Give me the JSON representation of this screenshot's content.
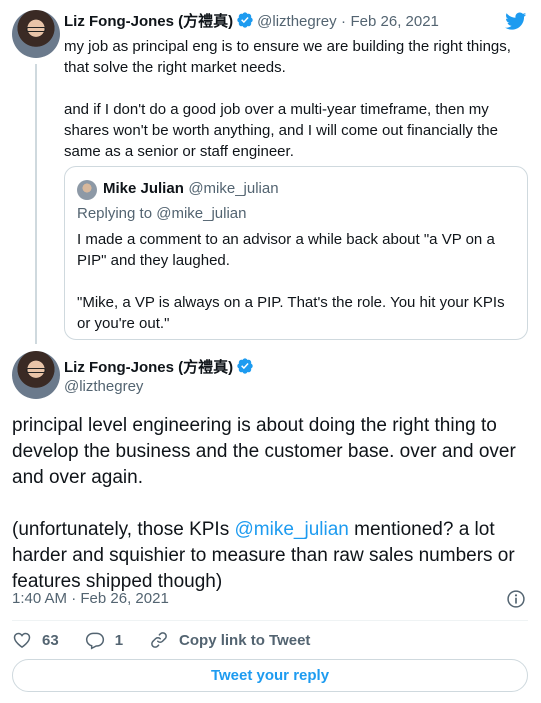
{
  "colors": {
    "accent": "#1d9bf0",
    "secondary_text": "#536471",
    "border": "#cfd9de",
    "text": "#0f1419"
  },
  "tweet1": {
    "name": "Liz Fong-Jones (方禮真)",
    "handle": "@lizthegrey",
    "separator": "·",
    "date": "Feb 26, 2021",
    "text": "my job as principal eng is to ensure we are building the right things, that solve the right market needs.\n\nand if I don't do a good job over a multi-year timeframe, then my shares won't be worth anything, and I will come out financially the same as a senior or staff engineer."
  },
  "quote": {
    "name": "Mike Julian",
    "handle": "@mike_julian",
    "replying_prefix": "Replying to",
    "replying_to": "@mike_julian",
    "text": "I made a comment to an advisor a while back about \"a VP on a PIP\" and they laughed.\n\n\"Mike, a VP is always on a PIP. That's the role. You hit your KPIs or you're out.\""
  },
  "main": {
    "name": "Liz Fong-Jones (方禮真)",
    "handle": "@lizthegrey",
    "paragraph1": "principal level engineering is about doing the right thing to develop the business and the customer base. over and over and over again.",
    "paragraph2_before": "(unfortunately, those KPIs ",
    "paragraph2_mention": "@mike_julian",
    "paragraph2_after": " mentioned? a lot harder and squishier to measure than raw sales numbers or features shipped though)",
    "time": "1:40 AM",
    "separator": "·",
    "date": "Feb 26, 2021"
  },
  "actions": {
    "like_count": "63",
    "reply_count": "1",
    "copy_link_label": "Copy link to Tweet"
  },
  "reply_button_label": "Tweet your reply",
  "icons": [
    "twitter-bird-icon",
    "verified-badge-icon",
    "info-icon",
    "heart-icon",
    "reply-bubble-icon",
    "link-icon"
  ]
}
